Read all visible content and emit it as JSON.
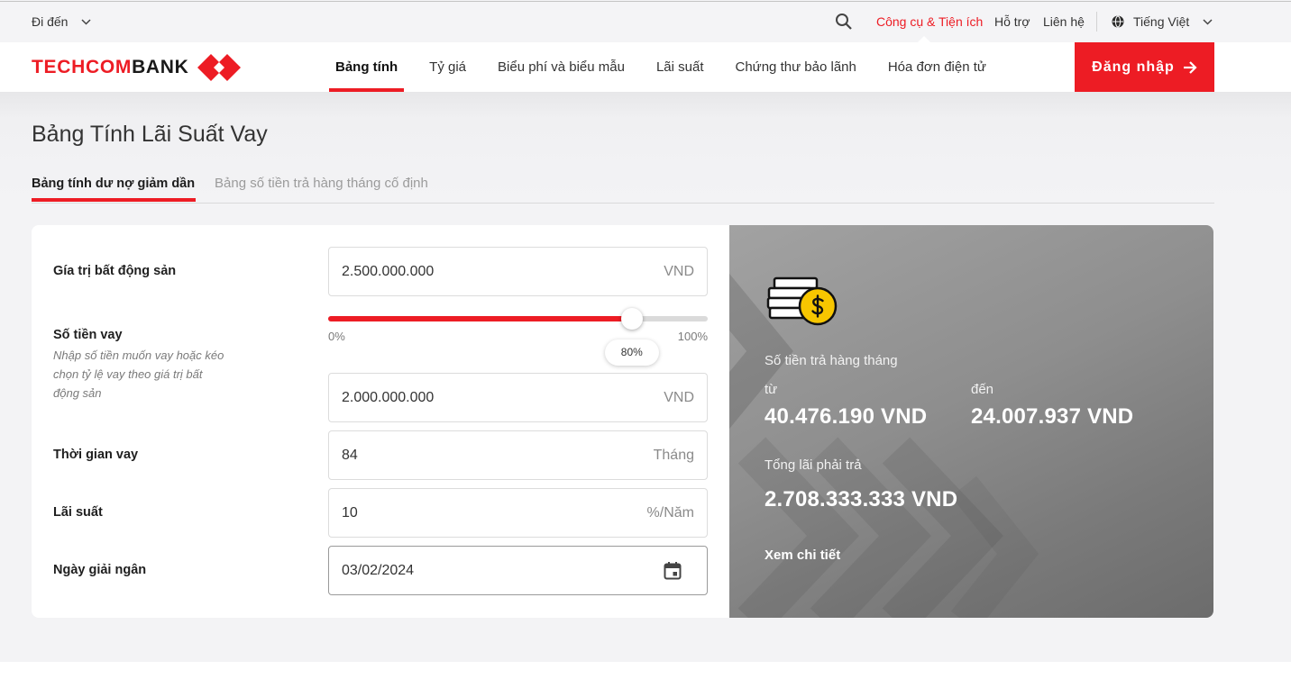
{
  "topbar": {
    "goto_label": "Đi đến",
    "tools_label": "Công cụ & Tiện ích",
    "support_label": "Hỗ trợ",
    "contact_label": "Liên hệ",
    "language_label": "Tiếng Việt",
    "icons": {
      "search": "search-icon",
      "language": "globe-icon",
      "dropdown": "chevron-down-icon"
    }
  },
  "brand": {
    "name_part1": "TECHCOM",
    "name_part2": "BANK"
  },
  "nav": {
    "items": [
      {
        "label": "Bảng tính",
        "active": true
      },
      {
        "label": "Tỷ giá",
        "active": false
      },
      {
        "label": "Biểu phí và biểu mẫu",
        "active": false
      },
      {
        "label": "Lãi suất",
        "active": false
      },
      {
        "label": "Chứng thư bảo lãnh",
        "active": false
      },
      {
        "label": "Hóa đơn điện tử",
        "active": false
      }
    ],
    "login_label": "Đăng nhập",
    "login_icon": "arrow-right-icon"
  },
  "page": {
    "title": "Bảng Tính Lãi Suất Vay",
    "tabs": [
      {
        "label": "Bảng tính dư nợ giảm dần",
        "active": true
      },
      {
        "label": "Bảng số tiền trả hàng tháng cố định",
        "active": false
      }
    ]
  },
  "form": {
    "property_value": {
      "label": "Gía trị bất động sản",
      "value": "2.500.000.000",
      "unit": "VND"
    },
    "loan_amount": {
      "label": "Số tiền vay",
      "hint_lines": [
        "Nhập số tiền muốn vay hoặc kéo",
        "chọn tỷ lệ vay theo giá trị bất",
        "động sản"
      ],
      "slider": {
        "min_label": "0%",
        "max_label": "100%",
        "value_label": "80%",
        "ratio": 0.8
      },
      "value": "2.000.000.000",
      "unit": "VND"
    },
    "term": {
      "label": "Thời gian vay",
      "value": "84",
      "unit": "Tháng"
    },
    "interest_rate": {
      "label": "Lãi suất",
      "value": "10",
      "unit": "%/Năm"
    },
    "disbursement_date": {
      "label": "Ngày giải ngân",
      "value": "03/02/2024",
      "icon": "calendar-icon"
    }
  },
  "result": {
    "icon": "money-coin-icon",
    "monthly_payment_label": "Số tiền trả hàng tháng",
    "from_label": "từ",
    "from_value": "40.476.190 VND",
    "to_label": "đến",
    "to_value": "24.007.937 VND",
    "total_interest_label": "Tổng lãi phải trả",
    "total_interest_value": "2.708.333.333 VND",
    "details_link": "Xem chi tiết"
  },
  "colors": {
    "accent": "#ed1c24",
    "panel": "#8a8a8a",
    "coin": "#f7c600"
  }
}
